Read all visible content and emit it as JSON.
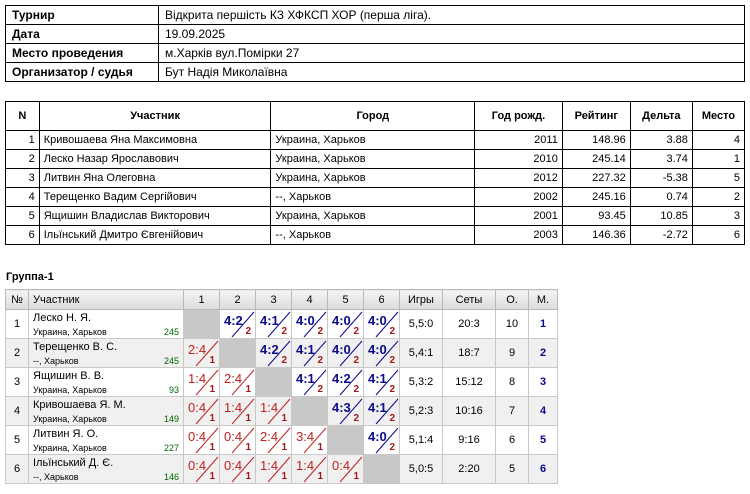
{
  "info": [
    {
      "key": "Турнир",
      "value": "Відкрита першість КЗ ХФКСП ХОР (перша ліга)."
    },
    {
      "key": "Дата",
      "value": "19.09.2025"
    },
    {
      "key": "Место проведения",
      "value": "м.Харків вул.Помірки 27"
    },
    {
      "key": "Организатор / судья",
      "value": "Бут Надія Миколаївна"
    }
  ],
  "players": {
    "headers": [
      "N",
      "Участник",
      "Город",
      "Год рожд.",
      "Рейтинг",
      "Дельта",
      "Место"
    ],
    "rows": [
      [
        "1",
        "Кривошаева Яна Максимовна",
        "Украина, Харьков",
        "2011",
        "148.96",
        "3.88",
        "4"
      ],
      [
        "2",
        "Леско Назар Ярославович",
        "Украина, Харьков",
        "2010",
        "245.14",
        "3.74",
        "1"
      ],
      [
        "3",
        "Литвин Яна Олеговна",
        "Украина, Харьков",
        "2012",
        "227.32",
        "-5.38",
        "5"
      ],
      [
        "4",
        "Терещенко Вадим Сергійович",
        "--, Харьков",
        "2002",
        "245.16",
        "0.74",
        "2"
      ],
      [
        "5",
        "Ящишин Владислав Викторович",
        "Украина, Харьков",
        "2001",
        "93.45",
        "10.85",
        "3"
      ],
      [
        "6",
        "Ільїнський Дмитро Євгенійович",
        "--, Харьков",
        "2003",
        "146.36",
        "-2.72",
        "6"
      ]
    ]
  },
  "group": {
    "title": "Группа-1",
    "headers": [
      "№",
      "Участник",
      "1",
      "2",
      "3",
      "4",
      "5",
      "6",
      "Игры",
      "Сеты",
      "О.",
      "М."
    ],
    "rows": [
      {
        "n": "1",
        "name": "Леско Н. Я.",
        "city": "Украина, Харьков",
        "rating": "245",
        "cells": [
          null,
          {
            "s": "4:2",
            "p": "2",
            "w": true
          },
          {
            "s": "4:1",
            "p": "2",
            "w": true
          },
          {
            "s": "4:0",
            "p": "2",
            "w": true
          },
          {
            "s": "4:0",
            "p": "2",
            "w": true
          },
          {
            "s": "4:0",
            "p": "2",
            "w": true
          }
        ],
        "games": "5,5:0",
        "sets": "20:3",
        "points": "10",
        "place": "1"
      },
      {
        "n": "2",
        "name": "Терещенко В. С.",
        "city": "--, Харьков",
        "rating": "245",
        "cells": [
          {
            "s": "2:4",
            "p": "1",
            "w": false
          },
          null,
          {
            "s": "4:2",
            "p": "2",
            "w": true
          },
          {
            "s": "4:1",
            "p": "2",
            "w": true
          },
          {
            "s": "4:0",
            "p": "2",
            "w": true
          },
          {
            "s": "4:0",
            "p": "2",
            "w": true
          }
        ],
        "games": "5,4:1",
        "sets": "18:7",
        "points": "9",
        "place": "2"
      },
      {
        "n": "3",
        "name": "Ящишин В. В.",
        "city": "Украина, Харьков",
        "rating": "93",
        "cells": [
          {
            "s": "1:4",
            "p": "1",
            "w": false
          },
          {
            "s": "2:4",
            "p": "1",
            "w": false
          },
          null,
          {
            "s": "4:1",
            "p": "2",
            "w": true
          },
          {
            "s": "4:2",
            "p": "2",
            "w": true
          },
          {
            "s": "4:1",
            "p": "2",
            "w": true
          }
        ],
        "games": "5,3:2",
        "sets": "15:12",
        "points": "8",
        "place": "3"
      },
      {
        "n": "4",
        "name": "Кривошаева Я. М.",
        "city": "Украина, Харьков",
        "rating": "149",
        "cells": [
          {
            "s": "0:4",
            "p": "1",
            "w": false
          },
          {
            "s": "1:4",
            "p": "1",
            "w": false
          },
          {
            "s": "1:4",
            "p": "1",
            "w": false
          },
          null,
          {
            "s": "4:3",
            "p": "2",
            "w": true
          },
          {
            "s": "4:1",
            "p": "2",
            "w": true
          }
        ],
        "games": "5,2:3",
        "sets": "10:16",
        "points": "7",
        "place": "4"
      },
      {
        "n": "5",
        "name": "Литвин Я. О.",
        "city": "Украина, Харьков",
        "rating": "227",
        "cells": [
          {
            "s": "0:4",
            "p": "1",
            "w": false
          },
          {
            "s": "0:4",
            "p": "1",
            "w": false
          },
          {
            "s": "2:4",
            "p": "1",
            "w": false
          },
          {
            "s": "3:4",
            "p": "1",
            "w": false
          },
          null,
          {
            "s": "4:0",
            "p": "2",
            "w": true
          }
        ],
        "games": "5,1:4",
        "sets": "9:16",
        "points": "6",
        "place": "5"
      },
      {
        "n": "6",
        "name": "Ільїнський Д. Є.",
        "city": "--, Харьков",
        "rating": "146",
        "cells": [
          {
            "s": "0:4",
            "p": "1",
            "w": false
          },
          {
            "s": "0:4",
            "p": "1",
            "w": false
          },
          {
            "s": "1:4",
            "p": "1",
            "w": false
          },
          {
            "s": "1:4",
            "p": "1",
            "w": false
          },
          {
            "s": "0:4",
            "p": "1",
            "w": false
          },
          null
        ],
        "games": "5,0:5",
        "sets": "2:20",
        "points": "5",
        "place": "6"
      }
    ]
  }
}
